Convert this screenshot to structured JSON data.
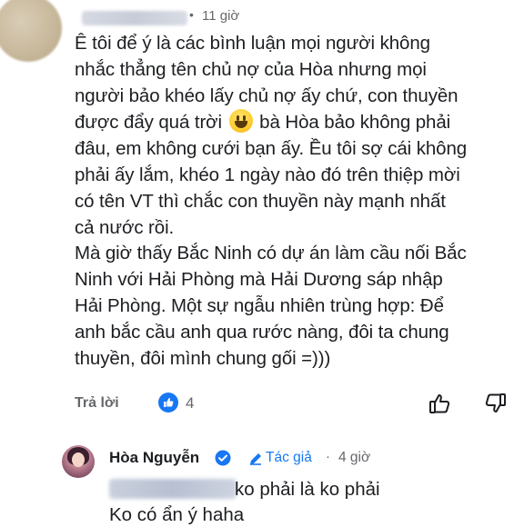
{
  "comment": {
    "time": "11 giờ",
    "dots": "•",
    "paragraph1_before_emoji": "Ê tôi để ý là các bình luận mọi người không\nnhắc thẳng tên chủ nợ của Hòa nhưng mọi\nngười bảo khéo lấy chủ nợ ấy chứ, con thuyền\nđược đẩy quá trời ",
    "emoji": "smiling-face-emoji",
    "paragraph1_after_emoji": " bà Hòa bảo không phải\nđâu, em không cưới bạn ấy. Ều tôi sợ cái không\nphải ấy lắm, khéo 1 ngày nào đó trên thiệp mời\ncó tên VT thì chắc con thuyền này mạnh nhất\ncả nước rồi.",
    "paragraph2": "Mà giờ thấy Bắc Ninh có dự án làm cầu nối Bắc\nNinh với Hải Phòng mà Hải Dương sáp nhập\nHải Phòng. Một sự ngẫu nhiên trùng hợp: Để\nanh bắc cầu anh qua rước nàng, đôi ta chung\nthuyền, đôi mình chung gối =)))",
    "reply_label": "Trả lời",
    "like_count": "4"
  },
  "reply": {
    "author": "Hòa Nguyễn",
    "author_badge": "Tác giả",
    "dot": "·",
    "time": "4 giờ",
    "line1": "ko phải là ko phải",
    "line2": "Ko có ẩn ý haha"
  },
  "colors": {
    "accent": "#1877f2",
    "muted": "#65676b",
    "text": "#1c1e21"
  }
}
